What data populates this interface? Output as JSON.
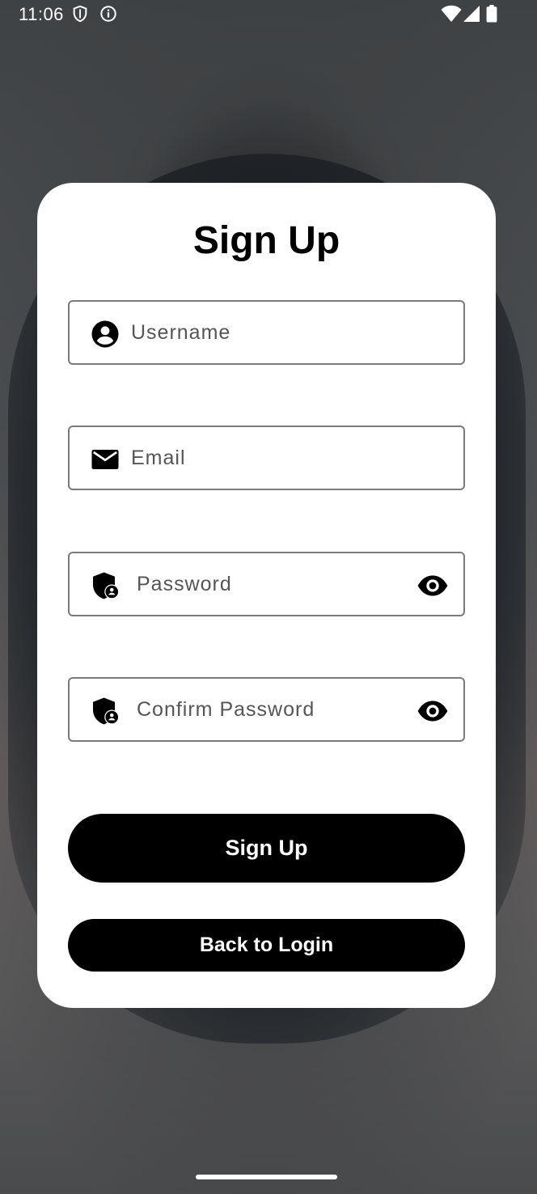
{
  "status_bar": {
    "time": "11:06",
    "left_icons": [
      "shield-icon",
      "info-icon"
    ],
    "right_icons": [
      "wifi-icon",
      "signal-icon",
      "battery-icon"
    ]
  },
  "card": {
    "title": "Sign Up",
    "fields": {
      "username": {
        "placeholder": "Username",
        "value": "",
        "icon": "person-icon"
      },
      "email": {
        "placeholder": "Email",
        "value": "",
        "icon": "mail-icon"
      },
      "password": {
        "placeholder": "Password",
        "value": "",
        "icon": "shield-lock-icon",
        "toggle_icon": "eye-icon"
      },
      "confirm_password": {
        "placeholder": "Confirm Password",
        "value": "",
        "icon": "shield-lock-icon",
        "toggle_icon": "eye-icon"
      }
    },
    "buttons": {
      "sign_up": "Sign Up",
      "back_to_login": "Back to Login"
    }
  },
  "colors": {
    "card_background": "#ffffff",
    "button_background": "#000000",
    "button_text": "#ffffff",
    "field_border": "#7a7a7a"
  }
}
